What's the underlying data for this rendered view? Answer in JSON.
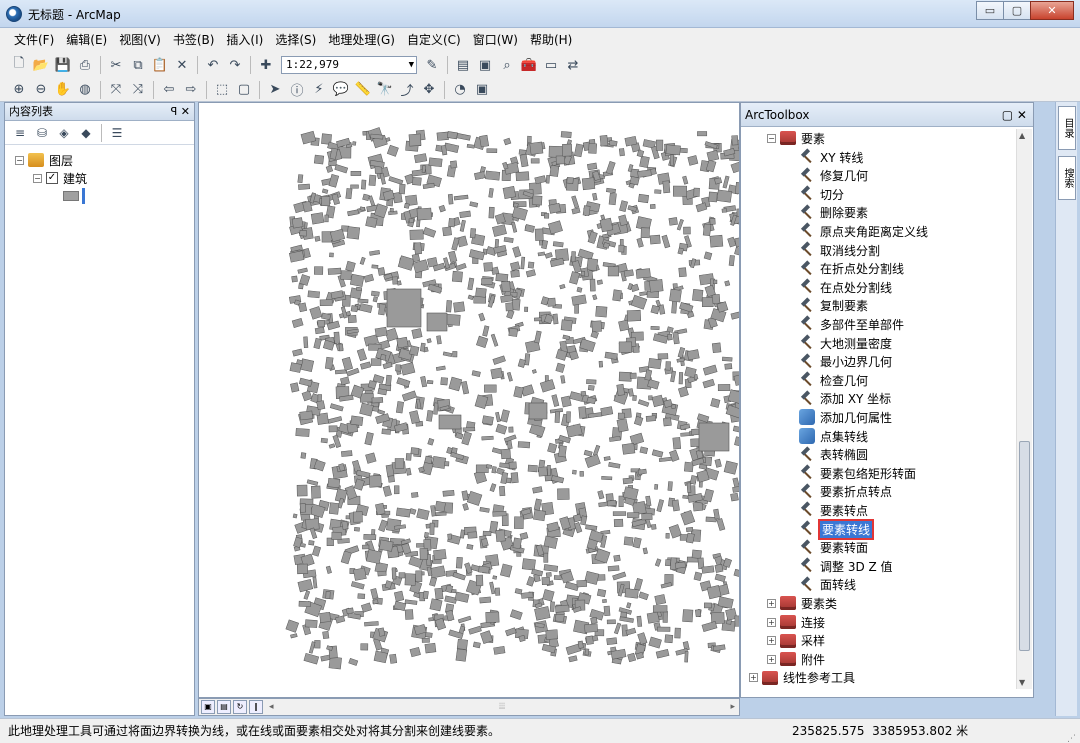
{
  "window": {
    "title": "无标题 - ArcMap",
    "btn_min": "▭",
    "btn_max": "▢",
    "btn_close": "✕"
  },
  "menu": [
    "文件(F)",
    "编辑(E)",
    "视图(V)",
    "书签(B)",
    "插入(I)",
    "选择(S)",
    "地理处理(G)",
    "自定义(C)",
    "窗口(W)",
    "帮助(H)"
  ],
  "toolbar": {
    "scale": "1:22,979"
  },
  "toc": {
    "title": "内容列表",
    "header_icons": "ꟼ ✕",
    "root_label": "图层",
    "layer_label": "建筑",
    "layer_checked": "✓"
  },
  "toolbox": {
    "title": "ArcToolbox",
    "header_icons": "▢ ✕",
    "toolset": "要素",
    "tools": [
      {
        "label": "XY 转线",
        "icon": "hammer-icon"
      },
      {
        "label": "修复几何",
        "icon": "hammer-icon"
      },
      {
        "label": "切分",
        "icon": "hammer-icon"
      },
      {
        "label": "删除要素",
        "icon": "hammer-icon"
      },
      {
        "label": "原点夹角距离定义线",
        "icon": "hammer-icon"
      },
      {
        "label": "取消线分割",
        "icon": "hammer-icon"
      },
      {
        "label": "在折点处分割线",
        "icon": "hammer-icon"
      },
      {
        "label": "在点处分割线",
        "icon": "hammer-icon"
      },
      {
        "label": "复制要素",
        "icon": "hammer-icon"
      },
      {
        "label": "多部件至单部件",
        "icon": "hammer-icon"
      },
      {
        "label": "大地测量密度",
        "icon": "hammer-icon"
      },
      {
        "label": "最小边界几何",
        "icon": "hammer-icon"
      },
      {
        "label": "检查几何",
        "icon": "hammer-icon"
      },
      {
        "label": "添加 XY 坐标",
        "icon": "hammer-icon"
      },
      {
        "label": "添加几何属性",
        "icon": "script-icon"
      },
      {
        "label": "点集转线",
        "icon": "script-icon"
      },
      {
        "label": "表转椭圆",
        "icon": "hammer-icon"
      },
      {
        "label": "要素包络矩形转面",
        "icon": "hammer-icon"
      },
      {
        "label": "要素折点转点",
        "icon": "hammer-icon"
      },
      {
        "label": "要素转点",
        "icon": "hammer-icon"
      },
      {
        "label": "要素转线",
        "icon": "hammer-icon",
        "selected": true
      },
      {
        "label": "要素转面",
        "icon": "hammer-icon"
      },
      {
        "label": "调整 3D Z 值",
        "icon": "hammer-icon"
      },
      {
        "label": "面转线",
        "icon": "hammer-icon"
      }
    ],
    "collapsed_toolsets": [
      "要素类",
      "连接",
      "采样",
      "附件"
    ],
    "root_collapsed": "线性参考工具"
  },
  "dock": {
    "tab1": "目录",
    "tab2": "搜索"
  },
  "status": {
    "message": "此地理处理工具可通过将面边界转换为线，或在线或面要素相交处对将其分割来创建线要素。",
    "x": "235825.575",
    "y": "3385953.802",
    "unit": "米"
  }
}
